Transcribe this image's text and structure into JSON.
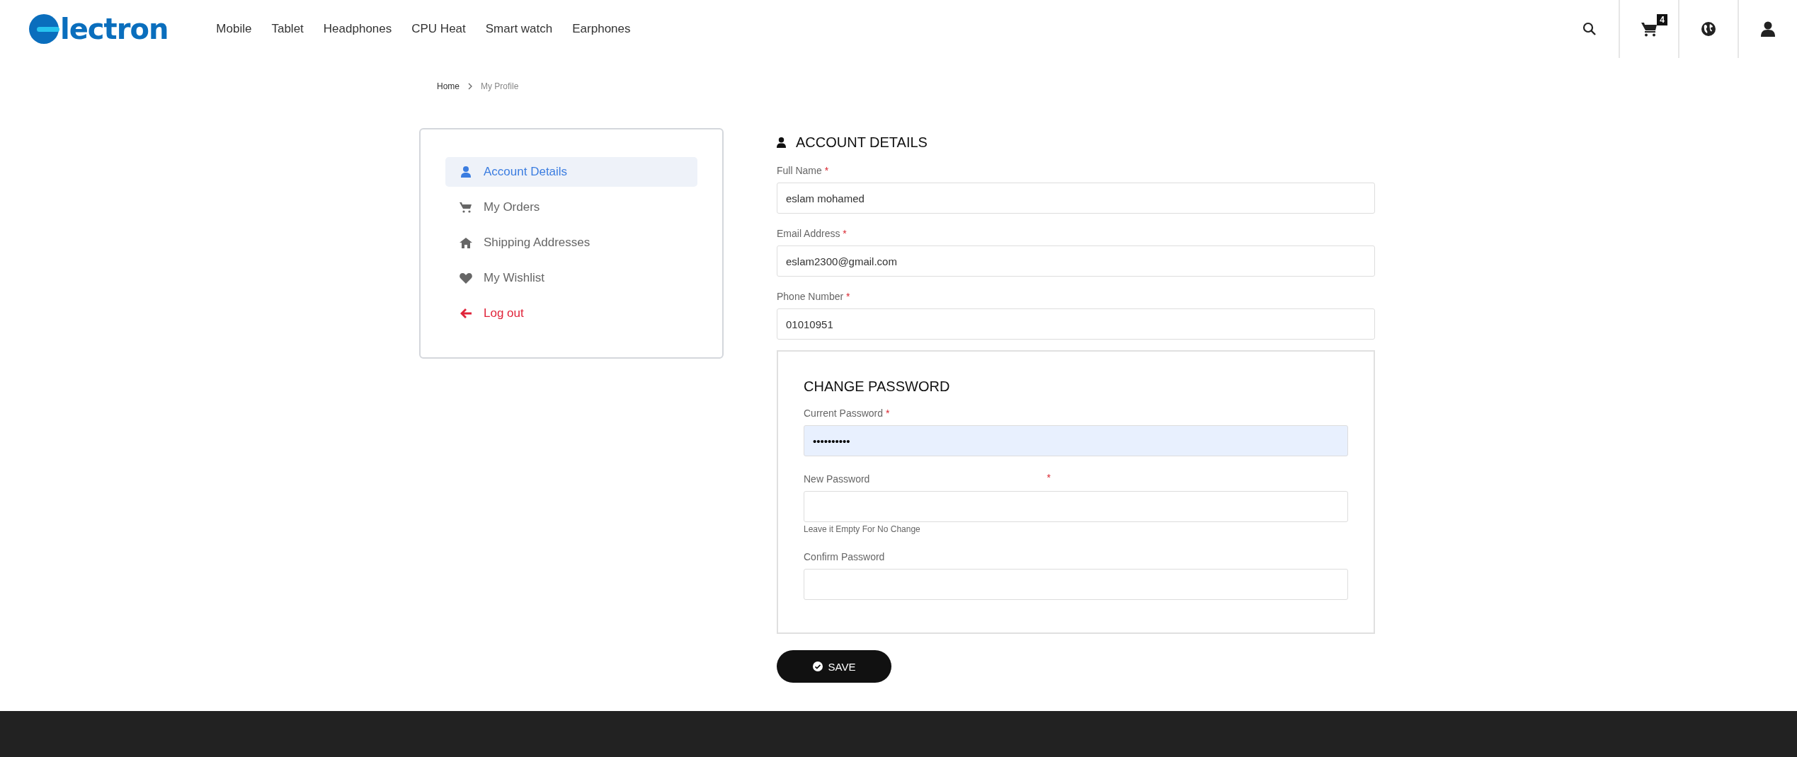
{
  "header": {
    "logo_text": "lectron",
    "nav": [
      "Mobile",
      "Tablet",
      "Headphones",
      "CPU Heat",
      "Smart watch",
      "Earphones"
    ],
    "cart_count": "4"
  },
  "breadcrumb": [
    {
      "label": "Home",
      "current": false
    },
    {
      "label": "My Profile",
      "current": true
    }
  ],
  "sidebar": {
    "items": [
      {
        "kind": "account",
        "label": "Account Details",
        "selected": true
      },
      {
        "kind": "orders",
        "label": "My Orders",
        "selected": false
      },
      {
        "kind": "addresses",
        "label": "Shipping Addresses",
        "selected": false
      },
      {
        "kind": "wishlist",
        "label": "My Wishlist",
        "selected": false
      },
      {
        "kind": "logout",
        "label": "Log out",
        "selected": false
      }
    ]
  },
  "account": {
    "title": "ACCOUNT DETAILS",
    "fields": [
      {
        "label": "Full Name",
        "required_mark": "*",
        "value": "eslam mohamed"
      },
      {
        "label": "Email Address",
        "required_mark": "*",
        "value": "eslam2300@gmail.com"
      },
      {
        "label": "Phone Number",
        "required_mark": "*",
        "value": "01010951"
      }
    ]
  },
  "change_password": {
    "title": "CHANGE PASSWORD",
    "fields": [
      {
        "label": "Current Password",
        "required_mark": "*",
        "value": "••••••••••",
        "autofilled": true
      },
      {
        "label": "New Password",
        "required_mark": "*",
        "mark_detached": true,
        "autofilled": false,
        "hint": "Leave it Empty For No Change"
      },
      {
        "label": "Confirm Password",
        "autofilled": false
      }
    ]
  },
  "save_button": "SAVE"
}
